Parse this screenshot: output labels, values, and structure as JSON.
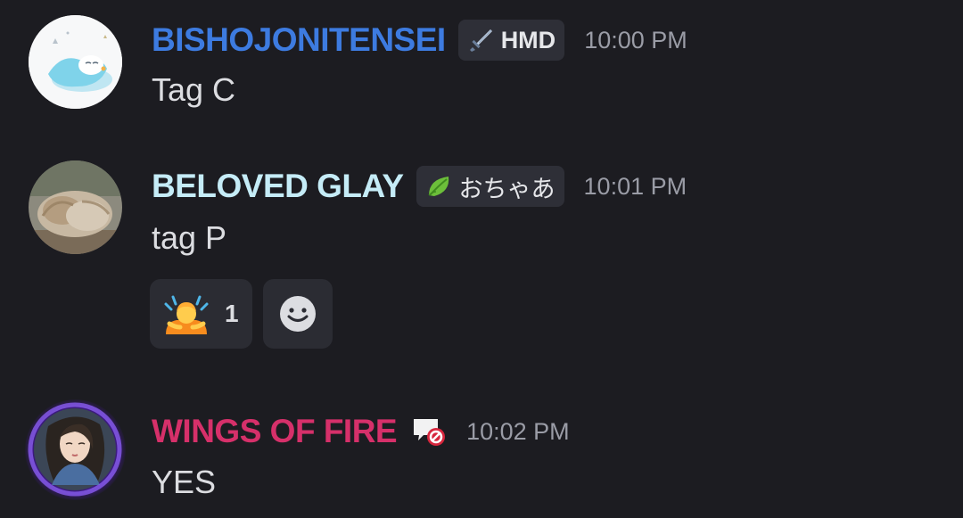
{
  "messages": [
    {
      "username": "BISHOJONITENSEI",
      "username_color": "#3d7be0",
      "tag": "HMD",
      "tag_icon": "sword-icon",
      "timestamp": "10:00 PM",
      "content": "Tag C"
    },
    {
      "username": "BELOVED GLAY",
      "username_color": "#c5ecf7",
      "tag": "おちゃあ",
      "tag_icon": "leaf-icon",
      "timestamp": "10:01 PM",
      "content": "tag P",
      "reactions": [
        {
          "emoji": "person-raising-hand-emoji",
          "count": "1"
        },
        {
          "emoji": "add-reaction-icon"
        }
      ]
    },
    {
      "username": "WINGS OF FIRE",
      "username_color": "#d6306a",
      "badge_icon": "no-chat-badge-icon",
      "timestamp": "10:02 PM",
      "content": "YES"
    }
  ]
}
